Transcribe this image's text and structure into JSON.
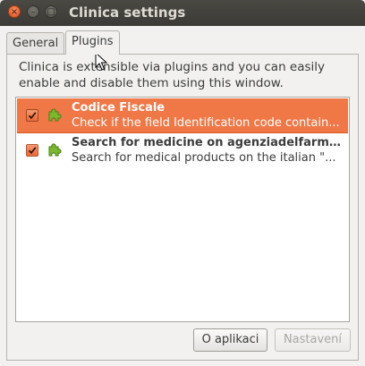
{
  "window": {
    "title": "Clinica settings",
    "close_glyph": "×",
    "minimize_glyph": "–",
    "maximize_glyph": "□"
  },
  "tabs": [
    {
      "label": "General",
      "selected": false
    },
    {
      "label": "Plugins",
      "selected": true
    }
  ],
  "plugins_tab": {
    "description": "Clinica is extensible via plugins and you can easily enable and disable them using this window.",
    "plugins": [
      {
        "name": "Codice Fiscale",
        "description": "Check if the field Identification code contain...",
        "enabled": true,
        "selected": true,
        "icon": "puzzle-piece-icon"
      },
      {
        "name": "Search for medicine on agenziadelfarmac...",
        "description": "Search for medical products on the italian \"...",
        "enabled": true,
        "selected": false,
        "icon": "puzzle-piece-icon"
      }
    ],
    "about_button": "O aplikaci",
    "settings_button": "Nastavení"
  },
  "colors": {
    "selection": "#f07746",
    "titlebar": "#3b3a36",
    "window_bg": "#f2f1f0",
    "plugin_icon": "#7ab82e"
  }
}
